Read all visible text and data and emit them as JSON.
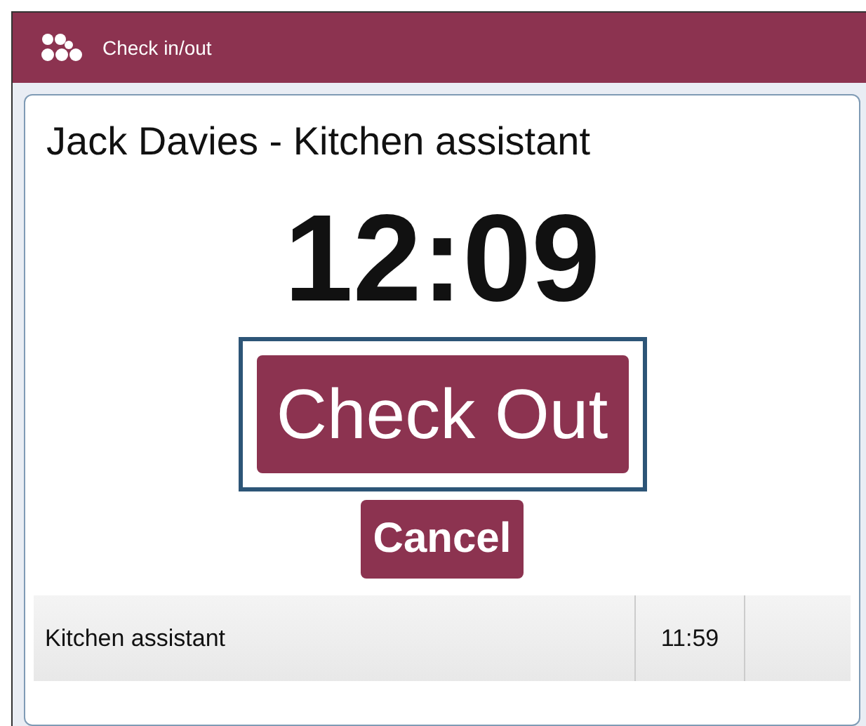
{
  "header": {
    "title": "Check in/out"
  },
  "employee": {
    "title": "Jack Davies - Kitchen assistant"
  },
  "clock": {
    "time": "12:09"
  },
  "primary_action": {
    "label": "Check Out",
    "focused": true
  },
  "cancel_action": {
    "label": "Cancel"
  },
  "shifts": [
    {
      "role": "Kitchen assistant",
      "time": "11:59"
    }
  ]
}
